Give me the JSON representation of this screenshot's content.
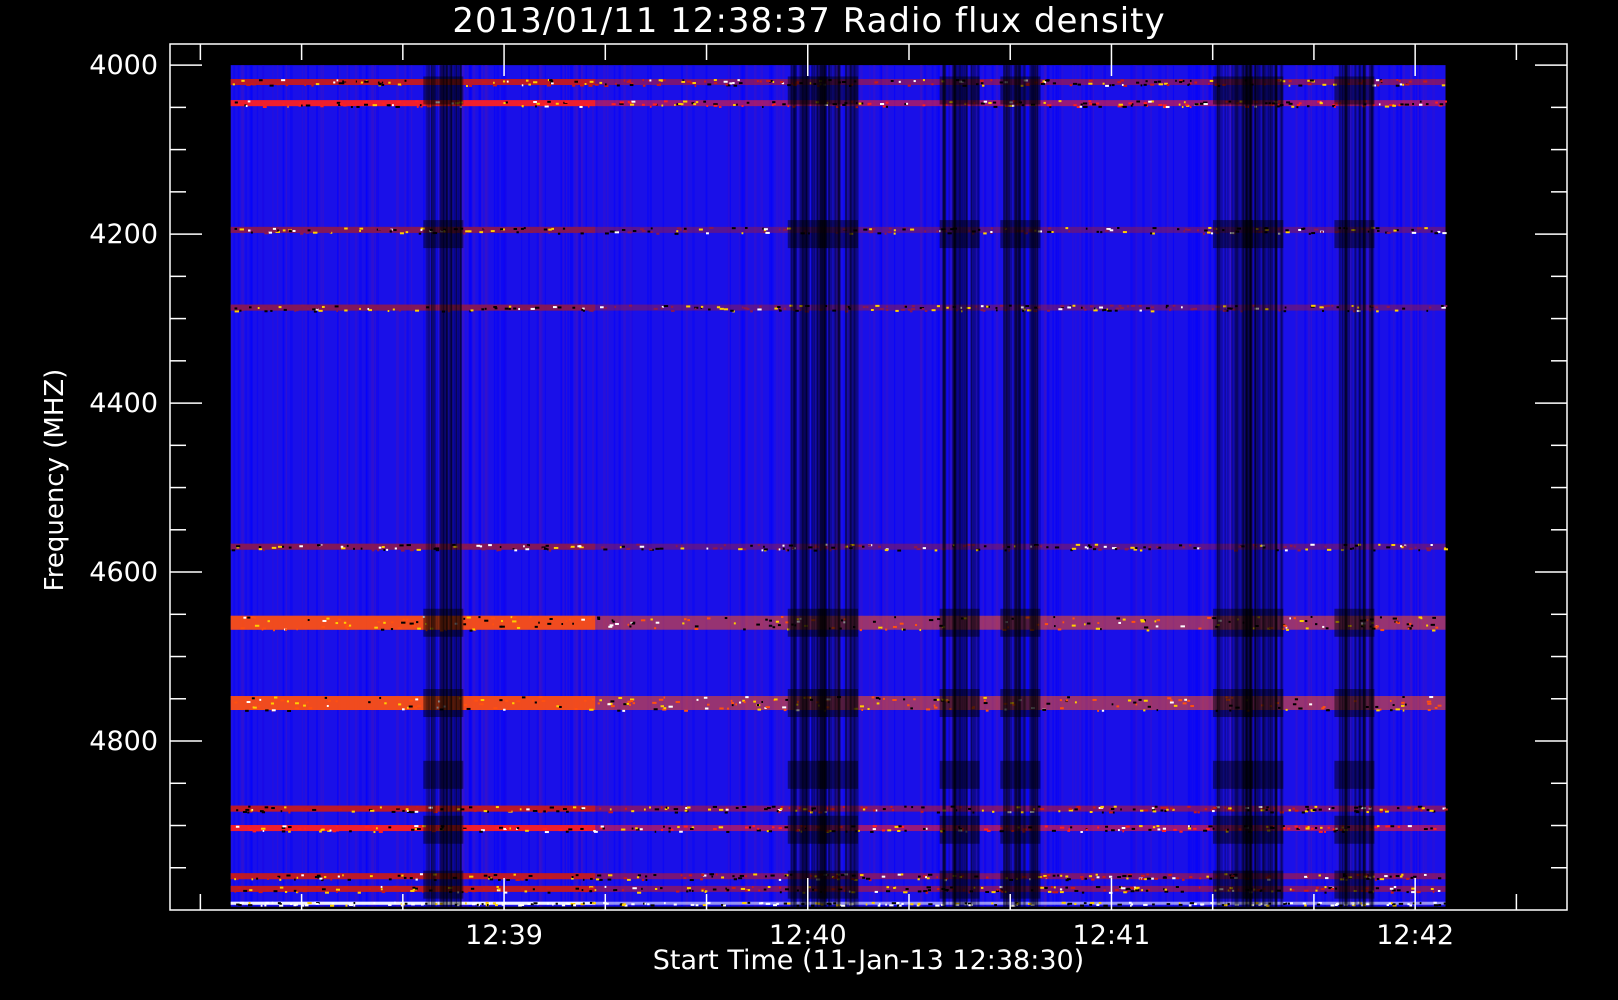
{
  "title": "2013/01/11 12:38:37 Radio flux density",
  "chart_data": {
    "type": "heatmap",
    "title": "2013/01/11 12:38:37 Radio flux density",
    "xlabel": "Start Time (11-Jan-13 12:38:30)",
    "ylabel": "Frequency (MHZ)",
    "x_ticks": [
      "12:39",
      "12:40",
      "12:41",
      "12:42"
    ],
    "x_tick_minutes": [
      0.5,
      1.5,
      2.5,
      3.5
    ],
    "x_range_minutes": [
      -0.6,
      4.0
    ],
    "data_time_range_minutes": [
      -0.4,
      3.6
    ],
    "y_ticks": [
      4000,
      4200,
      4400,
      4600,
      4800
    ],
    "ylim": [
      3975,
      5000
    ],
    "data_freq_range": [
      4000,
      4996
    ],
    "colorscale": [
      "#000000",
      "#0000ff",
      "#ff0000",
      "#ffff00",
      "#ffffff"
    ],
    "background_level": "blue",
    "emission_bands_mhz": [
      {
        "freq": 4020,
        "intensity": "red"
      },
      {
        "freq": 4045,
        "intensity": "bright red"
      },
      {
        "freq": 4195,
        "intensity": "dark red"
      },
      {
        "freq": 4287,
        "intensity": "dark red"
      },
      {
        "freq": 4570,
        "intensity": "dark red"
      },
      {
        "freq": 4660,
        "intensity": "orange/yellow"
      },
      {
        "freq": 4755,
        "intensity": "orange/yellow"
      },
      {
        "freq": 4880,
        "intensity": "red"
      },
      {
        "freq": 4903,
        "intensity": "bright red"
      },
      {
        "freq": 4960,
        "intensity": "red"
      },
      {
        "freq": 4975,
        "intensity": "red"
      },
      {
        "freq": 4992,
        "intensity": "white"
      }
    ],
    "dark_time_columns_minutes": [
      0.3,
      1.5,
      1.6,
      2.2,
      2.0,
      2.9,
      3.0,
      3.3
    ]
  }
}
